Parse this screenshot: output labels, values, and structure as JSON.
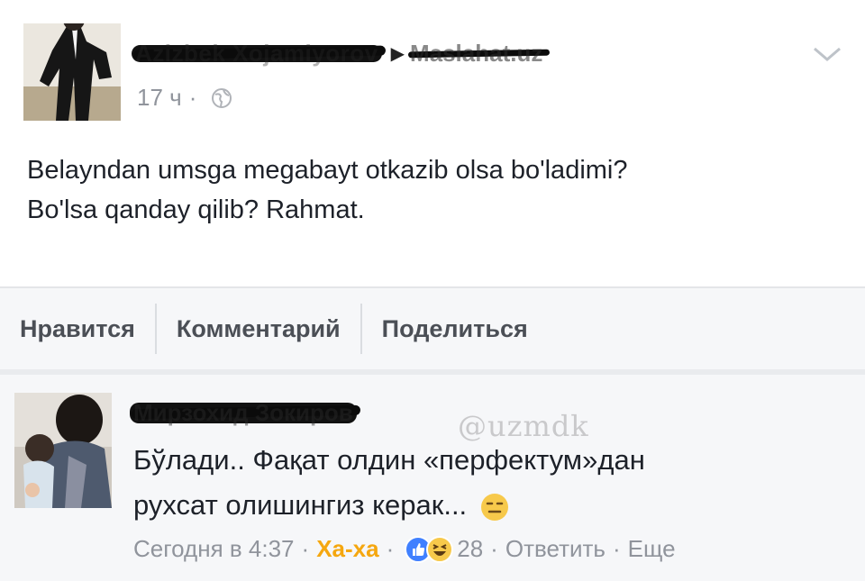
{
  "post": {
    "author": "Azizbek Xojamiyorov",
    "group": "Maslahat.uz",
    "time": "17 ч",
    "text_line1": "Belayndan umsga megabayt otkazib olsa bo'ladimi?",
    "text_line2": "Bo'lsa qanday qilib? Rahmat."
  },
  "actions": {
    "like": "Нравится",
    "comment": "Комментарий",
    "share": "Поделиться"
  },
  "comment": {
    "author": "Мирзохид Зокиров",
    "watermark": "@uzmdk",
    "text_line1": "Бўлади.. Фақат олдин «перфектум»дан",
    "text_line2": "рухсат олишингиз керак...",
    "time": "Сегодня в 4:37",
    "reaction_label": "Ха-ха",
    "reaction_count": "28",
    "reply": "Ответить",
    "more": "Еще"
  },
  "icons": {
    "globe": "globe-icon",
    "chevron": "chevron-down-icon",
    "like_reaction": "thumbs-up-reaction-icon",
    "haha_reaction": "laughing-face-reaction-icon",
    "expressionless": "expressionless-face-emoji"
  },
  "colors": {
    "haha": "#f5a70f",
    "meta": "#90949c",
    "like_blue": "#4080ff"
  }
}
